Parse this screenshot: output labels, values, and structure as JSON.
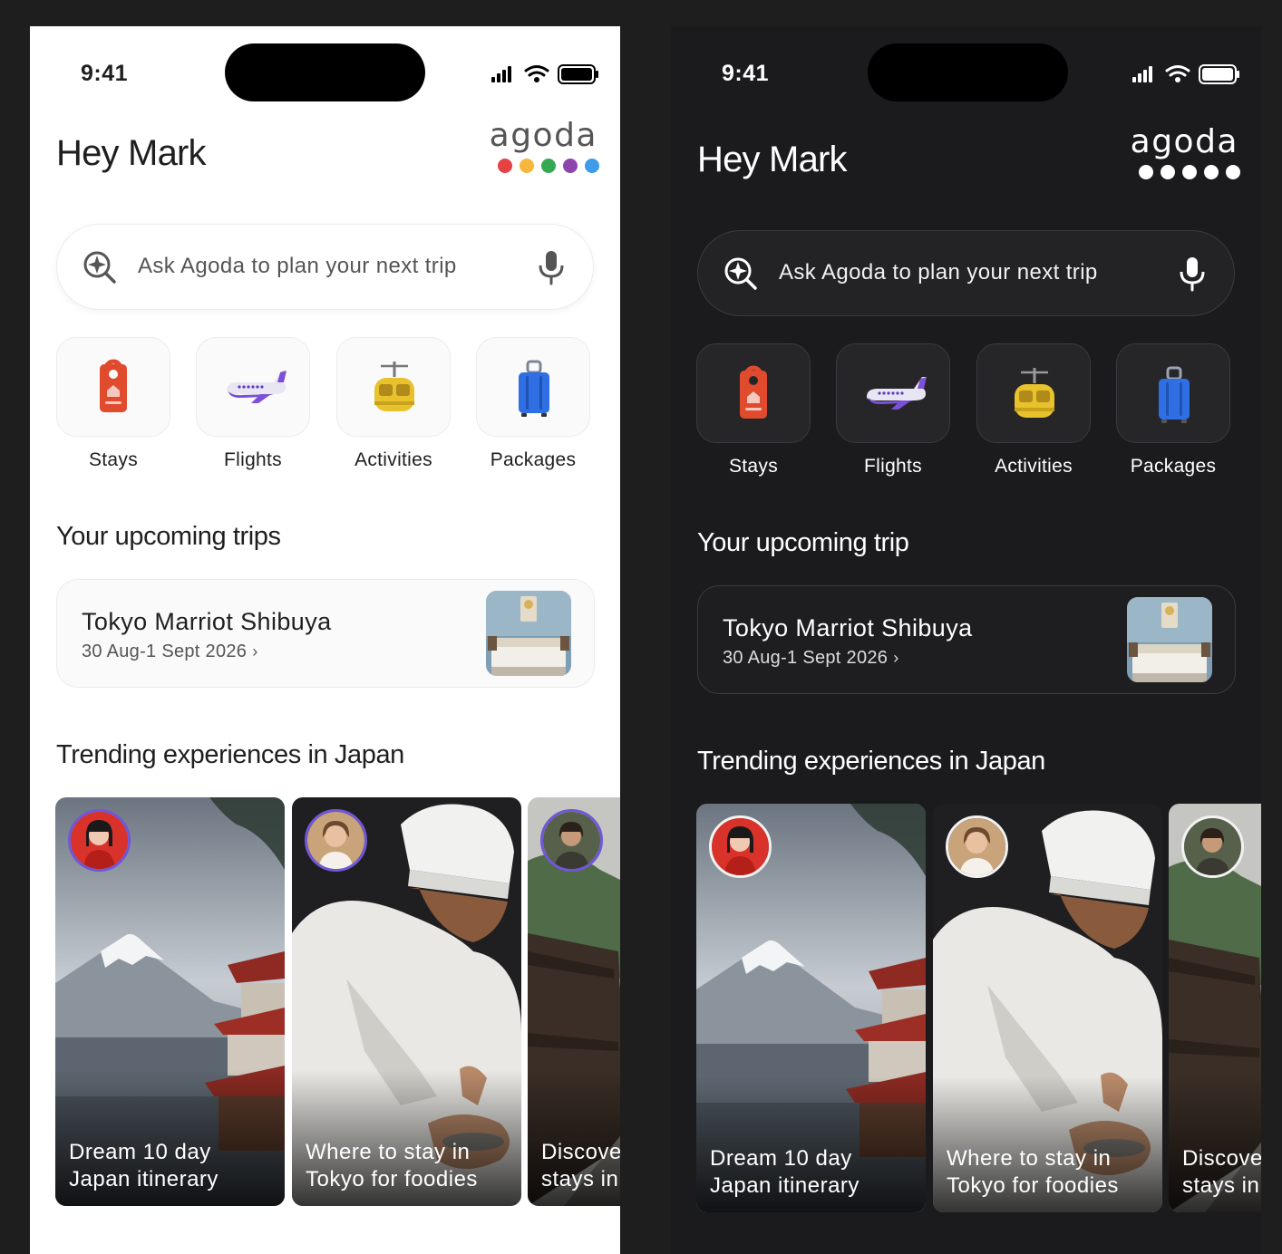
{
  "light": {
    "status": {
      "time": "9:41"
    },
    "greeting": "Hey Mark",
    "logo": "agoda",
    "logo_dot_colors": [
      "#e54343",
      "#f6b73c",
      "#34a853",
      "#8e44ad",
      "#3d9be9"
    ],
    "search": {
      "placeholder": "Ask Agoda to plan your next trip"
    },
    "categories": [
      {
        "label": "Stays",
        "icon": "door-hanger-icon"
      },
      {
        "label": "Flights",
        "icon": "airplane-icon"
      },
      {
        "label": "Activities",
        "icon": "cable-car-icon"
      },
      {
        "label": "Packages",
        "icon": "suitcase-icon"
      }
    ],
    "trips_title": "Your upcoming trips",
    "trip": {
      "name": "Tokyo Marriot Shibuya",
      "dates": "30 Aug-1 Sept 2026",
      "chevron": "›"
    },
    "trending_title": "Trending experiences in Japan",
    "experiences": [
      {
        "caption": "Dream 10 day\nJapan itinerary"
      },
      {
        "caption": "Where to stay in\nTokyo for foodies"
      },
      {
        "caption": "Discover\nstays in"
      }
    ]
  },
  "dark": {
    "status": {
      "time": "9:41"
    },
    "greeting": "Hey Mark",
    "logo": "agoda",
    "logo_dot_colors": [
      "#ffffff",
      "#ffffff",
      "#ffffff",
      "#ffffff",
      "#ffffff"
    ],
    "search": {
      "placeholder": "Ask Agoda to plan your next trip"
    },
    "categories": [
      {
        "label": "Stays",
        "icon": "door-hanger-icon"
      },
      {
        "label": "Flights",
        "icon": "airplane-icon"
      },
      {
        "label": "Activities",
        "icon": "cable-car-icon"
      },
      {
        "label": "Packages",
        "icon": "suitcase-icon"
      }
    ],
    "trips_title": "Your upcoming trip",
    "trip": {
      "name": "Tokyo Marriot Shibuya",
      "dates": "30 Aug-1 Sept 2026",
      "chevron": "›"
    },
    "trending_title": "Trending experiences in Japan",
    "experiences": [
      {
        "caption": "Dream 10 day\nJapan itinerary"
      },
      {
        "caption": "Where to stay in\nTokyo for foodies"
      },
      {
        "caption": "Discover\nstays in"
      }
    ]
  }
}
